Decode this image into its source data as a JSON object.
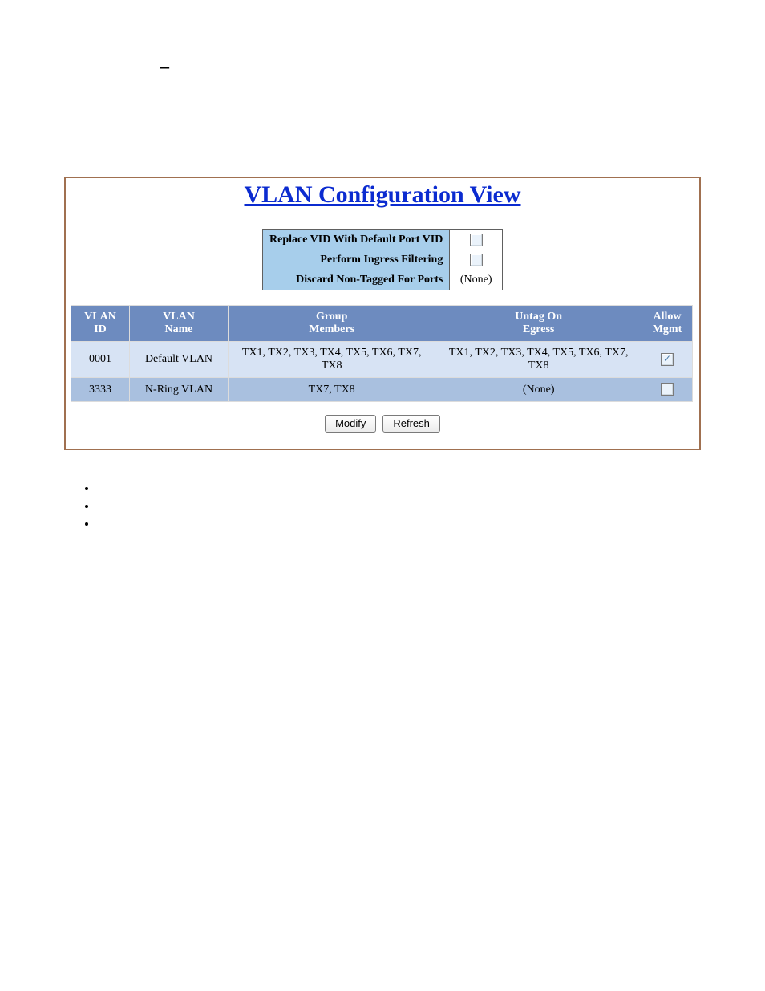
{
  "panel": {
    "title": "VLAN Configuration View",
    "settings": [
      {
        "label": "Replace VID With Default Port VID",
        "type": "checkbox",
        "checked": false
      },
      {
        "label": "Perform Ingress Filtering",
        "type": "checkbox",
        "checked": false
      },
      {
        "label": "Discard Non-Tagged For Ports",
        "type": "text",
        "value": "(None)"
      }
    ],
    "columns": {
      "c0": "VLAN\nID",
      "c1": "VLAN\nName",
      "c2": "Group\nMembers",
      "c3": "Untag On\nEgress",
      "c4": "Allow\nMgmt"
    },
    "rows": [
      {
        "id": "0001",
        "name": "Default VLAN",
        "members": "TX1, TX2, TX3, TX4, TX5, TX6, TX7, TX8",
        "untag": "TX1, TX2, TX3, TX4, TX5, TX6, TX7, TX8",
        "mgmt_checked": true
      },
      {
        "id": "3333",
        "name": "N-Ring VLAN",
        "members": "TX7, TX8",
        "untag": "(None)",
        "mgmt_checked": false
      }
    ],
    "buttons": {
      "modify": "Modify",
      "refresh": "Refresh"
    }
  },
  "bullets": [
    "",
    "",
    ""
  ]
}
